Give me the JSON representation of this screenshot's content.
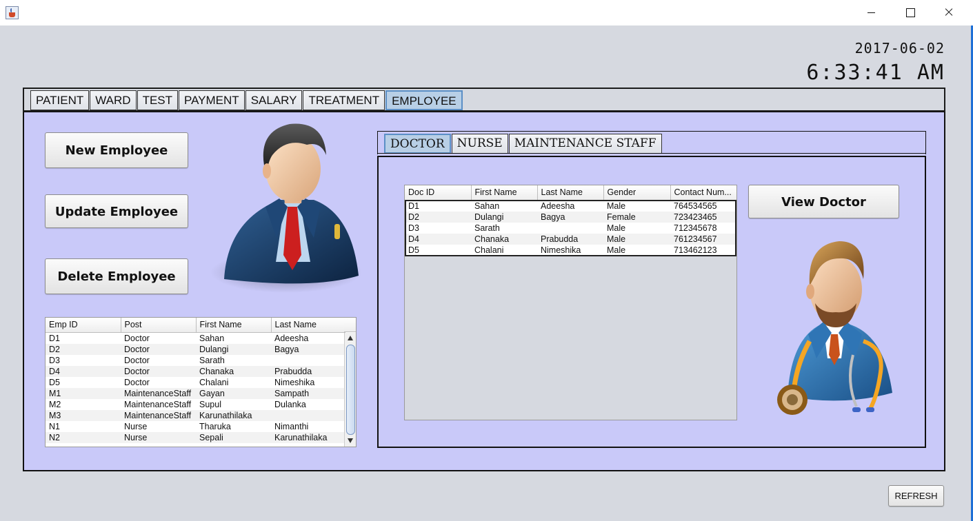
{
  "clock": {
    "date": "2017-06-02",
    "time": "6:33:41 AM"
  },
  "main_tabs": [
    "PATIENT",
    "WARD",
    "TEST",
    "PAYMENT",
    "SALARY",
    "TREATMENT",
    "EMPLOYEE"
  ],
  "active_main_tab": "EMPLOYEE",
  "buttons": {
    "new_employee": "New Employee",
    "update_employee": "Update Employee",
    "delete_employee": "Delete Employee",
    "view_doctor": "View Doctor",
    "refresh": "REFRESH"
  },
  "employee_table": {
    "headers": [
      "Emp ID",
      "Post",
      "First Name",
      "Last Name"
    ],
    "rows": [
      [
        "D1",
        "Doctor",
        "Sahan",
        "Adeesha"
      ],
      [
        "D2",
        "Doctor",
        "Dulangi",
        "Bagya"
      ],
      [
        "D3",
        "Doctor",
        "Sarath",
        ""
      ],
      [
        "D4",
        "Doctor",
        "Chanaka",
        "Prabudda"
      ],
      [
        "D5",
        "Doctor",
        "Chalani",
        "Nimeshika"
      ],
      [
        "M1",
        "MaintenanceStaff",
        "Gayan",
        "Sampath"
      ],
      [
        "M2",
        "MaintenanceStaff",
        "Supul",
        "Dulanka"
      ],
      [
        "M3",
        "MaintenanceStaff",
        "Karunathilaka",
        ""
      ],
      [
        "N1",
        "Nurse",
        "Tharuka",
        "Nimanthi"
      ],
      [
        "N2",
        "Nurse",
        "Sepali",
        "Karunathilaka"
      ]
    ]
  },
  "inner_tabs": [
    "DOCTOR",
    "NURSE",
    "MAINTENANCE STAFF"
  ],
  "active_inner_tab": "DOCTOR",
  "doctor_table": {
    "headers": [
      "Doc ID",
      "First Name",
      "Last Name",
      "Gender",
      "Contact Num..."
    ],
    "rows": [
      [
        "D1",
        "Sahan",
        "Adeesha",
        "Male",
        "764534565"
      ],
      [
        "D2",
        "Dulangi",
        "Bagya",
        "Female",
        "723423465"
      ],
      [
        "D3",
        "Sarath",
        "",
        "Male",
        "712345678"
      ],
      [
        "D4",
        "Chanaka",
        "Prabudda",
        "Male",
        "761234567"
      ],
      [
        "D5",
        "Chalani",
        "Nimeshika",
        "Male",
        "713462123"
      ]
    ]
  },
  "icons": {
    "app": "java-cup-icon",
    "employee_avatar": "businessman-avatar-icon",
    "doctor_avatar": "doctor-avatar-icon"
  },
  "colors": {
    "panel_bg": "#c9c9f9",
    "window_bg": "#d6d9e0",
    "active_tab": "#b8cfe6"
  }
}
